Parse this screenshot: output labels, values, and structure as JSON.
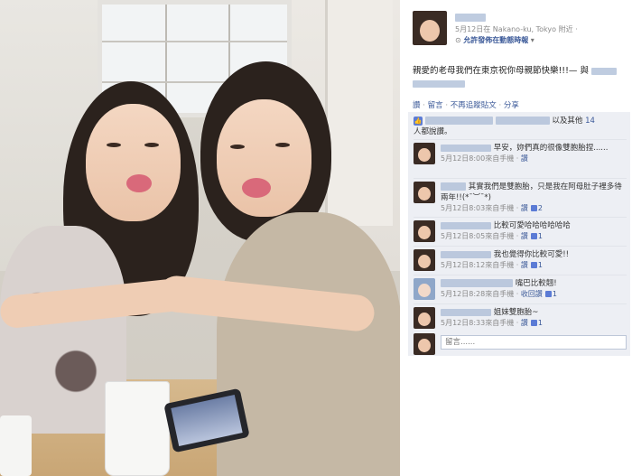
{
  "post": {
    "meta_line": "5月12日在 Nakano-ku, Tokyo 附近 ·",
    "privacy_line_prefix": "⊙",
    "privacy_line_bold": "允許發佈在動態時報",
    "privacy_line_caret": "▾",
    "text": "親愛的老母我們在東京祝你母親節快樂!!!— 與",
    "actions": {
      "like": "讚",
      "comment": "留言",
      "unfollow": "不再追蹤貼文",
      "share": "分享"
    },
    "likes": {
      "suffix": "以及其他",
      "others_link": "14",
      "people_text": "人都說讚。"
    }
  },
  "comments": [
    {
      "text": "早安，妳們真的很像雙胞胎捏......",
      "time": "5月12日8:00來自手機",
      "like_label": "讚",
      "like_count": ""
    },
    {
      "text": "其實我們是雙胞胎，只是我在阿母肚子裡多待兩年!!(*¯︶¯*)",
      "time": "5月12日8:03來自手機",
      "like_label": "讚",
      "like_count": "2"
    },
    {
      "text": "比較可愛哈哈哈哈哈哈",
      "time": "5月12日8:05來自手機",
      "like_label": "讚",
      "like_count": "1"
    },
    {
      "text": "我也覺得你比較可愛!!",
      "time": "5月12日8:12來自手機",
      "like_label": "讚",
      "like_count": "1"
    },
    {
      "text": "嘴巴比較翹!",
      "time": "5月12日8:28來自手機",
      "like_label": "收回讚",
      "like_count": "1"
    },
    {
      "text": "姐妹雙胞胎~",
      "time": "5月12日8:33來自手機",
      "like_label": "讚",
      "like_count": "1"
    }
  ],
  "composer": {
    "placeholder": "留言......"
  },
  "colors": {
    "link": "#3b5998",
    "ufi_bg": "#edeff4",
    "muted": "#8a8a8a"
  }
}
